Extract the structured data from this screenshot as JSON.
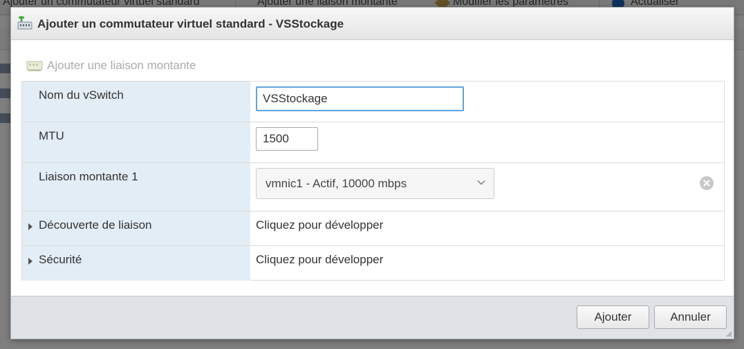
{
  "background": {
    "title": "Ajouter un commutateur virtuel standard",
    "toolbar": {
      "add_uplink_label": "Ajouter une liaison montante",
      "edit_settings_label": "Modifier les paramètres",
      "refresh_label": "Actualiser"
    }
  },
  "dialog": {
    "title": "Ajouter un commutateur virtuel standard - VSStockage",
    "add_uplink_label": "Ajouter une liaison montante",
    "rows": {
      "name": {
        "label": "Nom du vSwitch",
        "value": "VSStockage"
      },
      "mtu": {
        "label": "MTU",
        "value": "1500"
      },
      "uplink1": {
        "label": "Liaison montante 1",
        "value": "vmnic1 - Actif, 10000 mbps"
      },
      "link_discovery": {
        "label": "Découverte de liaison",
        "value": "Cliquez pour développer"
      },
      "security": {
        "label": "Sécurité",
        "value": "Cliquez pour développer"
      }
    },
    "footer": {
      "add_label": "Ajouter",
      "cancel_label": "Annuler"
    }
  },
  "colors": {
    "label_column_bg": "#e3edf5",
    "input_focus_border": "#5fa2dd",
    "footer_bg": "#dfe3e8"
  },
  "icons": {
    "dialog_icon": "network-switch-add-icon",
    "uplink_icon": "network-card-icon",
    "select_icon": "chevron-down-icon",
    "remove_icon": "remove-circle-icon",
    "expand_icon": "caret-right-icon",
    "resize_icon": "resize-grip-icon"
  }
}
